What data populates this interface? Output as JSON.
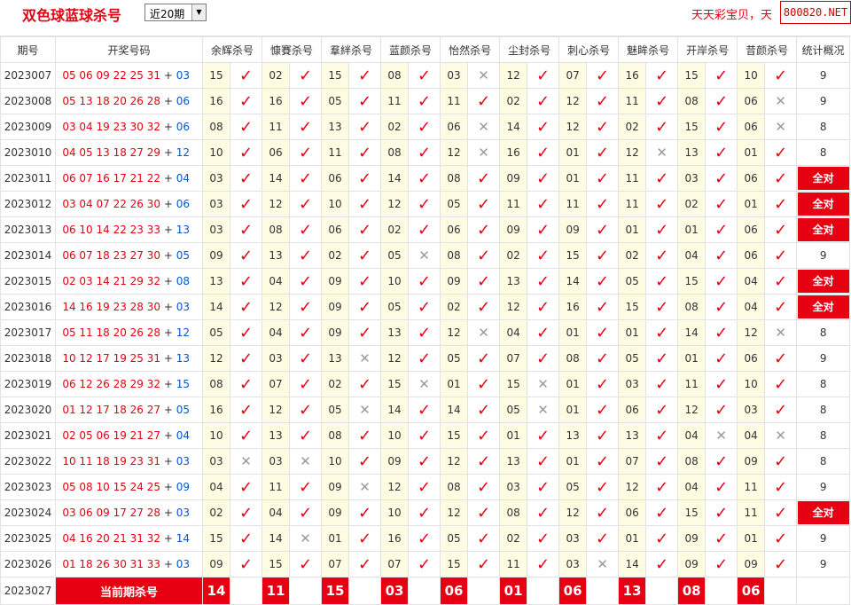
{
  "header": {
    "title": "双色球蓝球杀号",
    "period_select": "近20期",
    "ticker": "天天彩宝贝，天",
    "brand": "800820.NET"
  },
  "columns": [
    "期号",
    "开奖号码",
    "余辉杀号",
    "慷賽杀号",
    "羣絆杀号",
    "蓝颜杀号",
    "怡然杀号",
    "尘封杀号",
    "刺心杀号",
    "魅眸杀号",
    "开岸杀号",
    "昔颜杀号",
    "统计概况"
  ],
  "marks": {
    "hit": "✓",
    "miss": "✕"
  },
  "all_ok_label": "全对",
  "rows": [
    {
      "issue": "2023007",
      "red": "05 06 09 22 25 31",
      "blue": "03",
      "kills": [
        [
          "15",
          1
        ],
        [
          "02",
          1
        ],
        [
          "15",
          1
        ],
        [
          "08",
          1
        ],
        [
          "03",
          0
        ],
        [
          "12",
          1
        ],
        [
          "07",
          1
        ],
        [
          "16",
          1
        ],
        [
          "15",
          1
        ],
        [
          "10",
          1
        ]
      ],
      "stat": "9"
    },
    {
      "issue": "2023008",
      "red": "05 13 18 20 26 28",
      "blue": "06",
      "kills": [
        [
          "16",
          1
        ],
        [
          "16",
          1
        ],
        [
          "05",
          1
        ],
        [
          "11",
          1
        ],
        [
          "11",
          1
        ],
        [
          "02",
          1
        ],
        [
          "12",
          1
        ],
        [
          "11",
          1
        ],
        [
          "08",
          1
        ],
        [
          "06",
          0
        ]
      ],
      "stat": "9"
    },
    {
      "issue": "2023009",
      "red": "03 04 19 23 30 32",
      "blue": "06",
      "kills": [
        [
          "08",
          1
        ],
        [
          "11",
          1
        ],
        [
          "13",
          1
        ],
        [
          "02",
          1
        ],
        [
          "06",
          0
        ],
        [
          "14",
          1
        ],
        [
          "12",
          1
        ],
        [
          "02",
          1
        ],
        [
          "15",
          1
        ],
        [
          "06",
          0
        ]
      ],
      "stat": "8"
    },
    {
      "issue": "2023010",
      "red": "04 05 13 18 27 29",
      "blue": "12",
      "kills": [
        [
          "10",
          1
        ],
        [
          "06",
          1
        ],
        [
          "11",
          1
        ],
        [
          "08",
          1
        ],
        [
          "12",
          0
        ],
        [
          "16",
          1
        ],
        [
          "01",
          1
        ],
        [
          "12",
          0
        ],
        [
          "13",
          1
        ],
        [
          "01",
          1
        ]
      ],
      "stat": "8"
    },
    {
      "issue": "2023011",
      "red": "06 07 16 17 21 22",
      "blue": "04",
      "kills": [
        [
          "03",
          1
        ],
        [
          "14",
          1
        ],
        [
          "06",
          1
        ],
        [
          "14",
          1
        ],
        [
          "08",
          1
        ],
        [
          "09",
          1
        ],
        [
          "01",
          1
        ],
        [
          "11",
          1
        ],
        [
          "03",
          1
        ],
        [
          "06",
          1
        ]
      ],
      "stat": "全对"
    },
    {
      "issue": "2023012",
      "red": "03 04 07 22 26 30",
      "blue": "06",
      "kills": [
        [
          "03",
          1
        ],
        [
          "12",
          1
        ],
        [
          "10",
          1
        ],
        [
          "12",
          1
        ],
        [
          "05",
          1
        ],
        [
          "11",
          1
        ],
        [
          "11",
          1
        ],
        [
          "11",
          1
        ],
        [
          "02",
          1
        ],
        [
          "01",
          1
        ]
      ],
      "stat": "全对"
    },
    {
      "issue": "2023013",
      "red": "06 10 14 22 23 33",
      "blue": "13",
      "kills": [
        [
          "03",
          1
        ],
        [
          "08",
          1
        ],
        [
          "06",
          1
        ],
        [
          "02",
          1
        ],
        [
          "06",
          1
        ],
        [
          "09",
          1
        ],
        [
          "09",
          1
        ],
        [
          "01",
          1
        ],
        [
          "01",
          1
        ],
        [
          "06",
          1
        ]
      ],
      "stat": "全对"
    },
    {
      "issue": "2023014",
      "red": "06 07 18 23 27 30",
      "blue": "05",
      "kills": [
        [
          "09",
          1
        ],
        [
          "13",
          1
        ],
        [
          "02",
          1
        ],
        [
          "05",
          0
        ],
        [
          "08",
          1
        ],
        [
          "02",
          1
        ],
        [
          "15",
          1
        ],
        [
          "02",
          1
        ],
        [
          "04",
          1
        ],
        [
          "06",
          1
        ]
      ],
      "stat": "9"
    },
    {
      "issue": "2023015",
      "red": "02 03 14 21 29 32",
      "blue": "08",
      "kills": [
        [
          "13",
          1
        ],
        [
          "04",
          1
        ],
        [
          "09",
          1
        ],
        [
          "10",
          1
        ],
        [
          "09",
          1
        ],
        [
          "13",
          1
        ],
        [
          "14",
          1
        ],
        [
          "05",
          1
        ],
        [
          "15",
          1
        ],
        [
          "04",
          1
        ]
      ],
      "stat": "全对"
    },
    {
      "issue": "2023016",
      "red": "14 16 19 23 28 30",
      "blue": "03",
      "kills": [
        [
          "14",
          1
        ],
        [
          "12",
          1
        ],
        [
          "09",
          1
        ],
        [
          "05",
          1
        ],
        [
          "02",
          1
        ],
        [
          "12",
          1
        ],
        [
          "16",
          1
        ],
        [
          "15",
          1
        ],
        [
          "08",
          1
        ],
        [
          "04",
          1
        ]
      ],
      "stat": "全对"
    },
    {
      "issue": "2023017",
      "red": "05 11 18 20 26 28",
      "blue": "12",
      "kills": [
        [
          "05",
          1
        ],
        [
          "04",
          1
        ],
        [
          "09",
          1
        ],
        [
          "13",
          1
        ],
        [
          "12",
          0
        ],
        [
          "04",
          1
        ],
        [
          "01",
          1
        ],
        [
          "01",
          1
        ],
        [
          "14",
          1
        ],
        [
          "12",
          0
        ]
      ],
      "stat": "8"
    },
    {
      "issue": "2023018",
      "red": "10 12 17 19 25 31",
      "blue": "13",
      "kills": [
        [
          "12",
          1
        ],
        [
          "03",
          1
        ],
        [
          "13",
          0
        ],
        [
          "12",
          1
        ],
        [
          "05",
          1
        ],
        [
          "07",
          1
        ],
        [
          "08",
          1
        ],
        [
          "05",
          1
        ],
        [
          "01",
          1
        ],
        [
          "06",
          1
        ]
      ],
      "stat": "9"
    },
    {
      "issue": "2023019",
      "red": "06 12 26 28 29 32",
      "blue": "15",
      "kills": [
        [
          "08",
          1
        ],
        [
          "07",
          1
        ],
        [
          "02",
          1
        ],
        [
          "15",
          0
        ],
        [
          "01",
          1
        ],
        [
          "15",
          0
        ],
        [
          "01",
          1
        ],
        [
          "03",
          1
        ],
        [
          "11",
          1
        ],
        [
          "10",
          1
        ]
      ],
      "stat": "8"
    },
    {
      "issue": "2023020",
      "red": "01 12 17 18 26 27",
      "blue": "05",
      "kills": [
        [
          "16",
          1
        ],
        [
          "12",
          1
        ],
        [
          "05",
          0
        ],
        [
          "14",
          1
        ],
        [
          "14",
          1
        ],
        [
          "05",
          0
        ],
        [
          "01",
          1
        ],
        [
          "06",
          1
        ],
        [
          "12",
          1
        ],
        [
          "03",
          1
        ]
      ],
      "stat": "8"
    },
    {
      "issue": "2023021",
      "red": "02 05 06 19 21 27",
      "blue": "04",
      "kills": [
        [
          "10",
          1
        ],
        [
          "13",
          1
        ],
        [
          "08",
          1
        ],
        [
          "10",
          1
        ],
        [
          "15",
          1
        ],
        [
          "01",
          1
        ],
        [
          "13",
          1
        ],
        [
          "13",
          1
        ],
        [
          "04",
          0
        ],
        [
          "04",
          0
        ]
      ],
      "stat": "8"
    },
    {
      "issue": "2023022",
      "red": "10 11 18 19 23 31",
      "blue": "03",
      "kills": [
        [
          "03",
          0
        ],
        [
          "03",
          0
        ],
        [
          "10",
          1
        ],
        [
          "09",
          1
        ],
        [
          "12",
          1
        ],
        [
          "13",
          1
        ],
        [
          "01",
          1
        ],
        [
          "07",
          1
        ],
        [
          "08",
          1
        ],
        [
          "09",
          1
        ]
      ],
      "stat": "8"
    },
    {
      "issue": "2023023",
      "red": "05 08 10 15 24 25",
      "blue": "09",
      "kills": [
        [
          "04",
          1
        ],
        [
          "11",
          1
        ],
        [
          "09",
          0
        ],
        [
          "12",
          1
        ],
        [
          "08",
          1
        ],
        [
          "03",
          1
        ],
        [
          "05",
          1
        ],
        [
          "12",
          1
        ],
        [
          "04",
          1
        ],
        [
          "11",
          1
        ]
      ],
      "stat": "9"
    },
    {
      "issue": "2023024",
      "red": "03 06 09 17 27 28",
      "blue": "03",
      "kills": [
        [
          "02",
          1
        ],
        [
          "04",
          1
        ],
        [
          "09",
          1
        ],
        [
          "10",
          1
        ],
        [
          "12",
          1
        ],
        [
          "08",
          1
        ],
        [
          "12",
          1
        ],
        [
          "06",
          1
        ],
        [
          "15",
          1
        ],
        [
          "11",
          1
        ]
      ],
      "stat": "全对"
    },
    {
      "issue": "2023025",
      "red": "04 16 20 21 31 32",
      "blue": "14",
      "kills": [
        [
          "15",
          1
        ],
        [
          "14",
          0
        ],
        [
          "01",
          1
        ],
        [
          "16",
          1
        ],
        [
          "05",
          1
        ],
        [
          "02",
          1
        ],
        [
          "03",
          1
        ],
        [
          "01",
          1
        ],
        [
          "09",
          1
        ],
        [
          "01",
          1
        ]
      ],
      "stat": "9"
    },
    {
      "issue": "2023026",
      "red": "01 18 26 30 31 33",
      "blue": "03",
      "kills": [
        [
          "09",
          1
        ],
        [
          "15",
          1
        ],
        [
          "07",
          1
        ],
        [
          "07",
          1
        ],
        [
          "15",
          1
        ],
        [
          "11",
          1
        ],
        [
          "03",
          0
        ],
        [
          "14",
          1
        ],
        [
          "09",
          1
        ],
        [
          "09",
          1
        ]
      ],
      "stat": "9"
    }
  ],
  "current": {
    "issue": "2023027",
    "label": "当前期杀号",
    "kills": [
      "14",
      "11",
      "15",
      "03",
      "06",
      "01",
      "06",
      "13",
      "08",
      "06"
    ]
  }
}
